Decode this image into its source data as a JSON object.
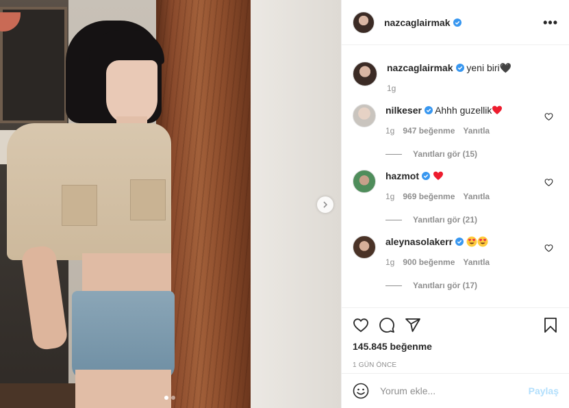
{
  "post": {
    "author": "nazcaglairmak",
    "caption_text": "yeni biri🖤",
    "caption_time": "1g",
    "likes": "145.845 beğenme",
    "posted": "1 GÜN ÖNCE",
    "slides": 2,
    "active_slide": 1
  },
  "comments": [
    {
      "username": "nilkeser",
      "text": "Ahhh guzellik",
      "emoji": "heart",
      "time": "1g",
      "likes": "947 beğenme",
      "reply": "Yanıtla",
      "view_replies": "Yanıtları gör (15)"
    },
    {
      "username": "hazmot",
      "text": "",
      "emoji": "heart",
      "time": "1g",
      "likes": "969 beğenme",
      "reply": "Yanıtla",
      "view_replies": "Yanıtları gör (21)"
    },
    {
      "username": "aleynasolakerr",
      "text": "",
      "emoji": "heart-eyes x2",
      "time": "1g",
      "likes": "900 beğenme",
      "reply": "Yanıtla",
      "view_replies": "Yanıtları gör (17)"
    }
  ],
  "add_comment": {
    "placeholder": "Yorum ekle...",
    "post_label": "Paylaş"
  },
  "icons": {
    "more": "more-options-icon",
    "like": "heart-outline-icon",
    "comment": "comment-icon",
    "share": "paper-plane-icon",
    "save": "bookmark-icon",
    "emoji": "smiley-icon",
    "next": "chevron-right-icon"
  },
  "colors": {
    "verified": "#3897f0",
    "heart": "#ed4956",
    "muted": "#8e8e8e",
    "post_button_disabled": "#b2dffc"
  }
}
